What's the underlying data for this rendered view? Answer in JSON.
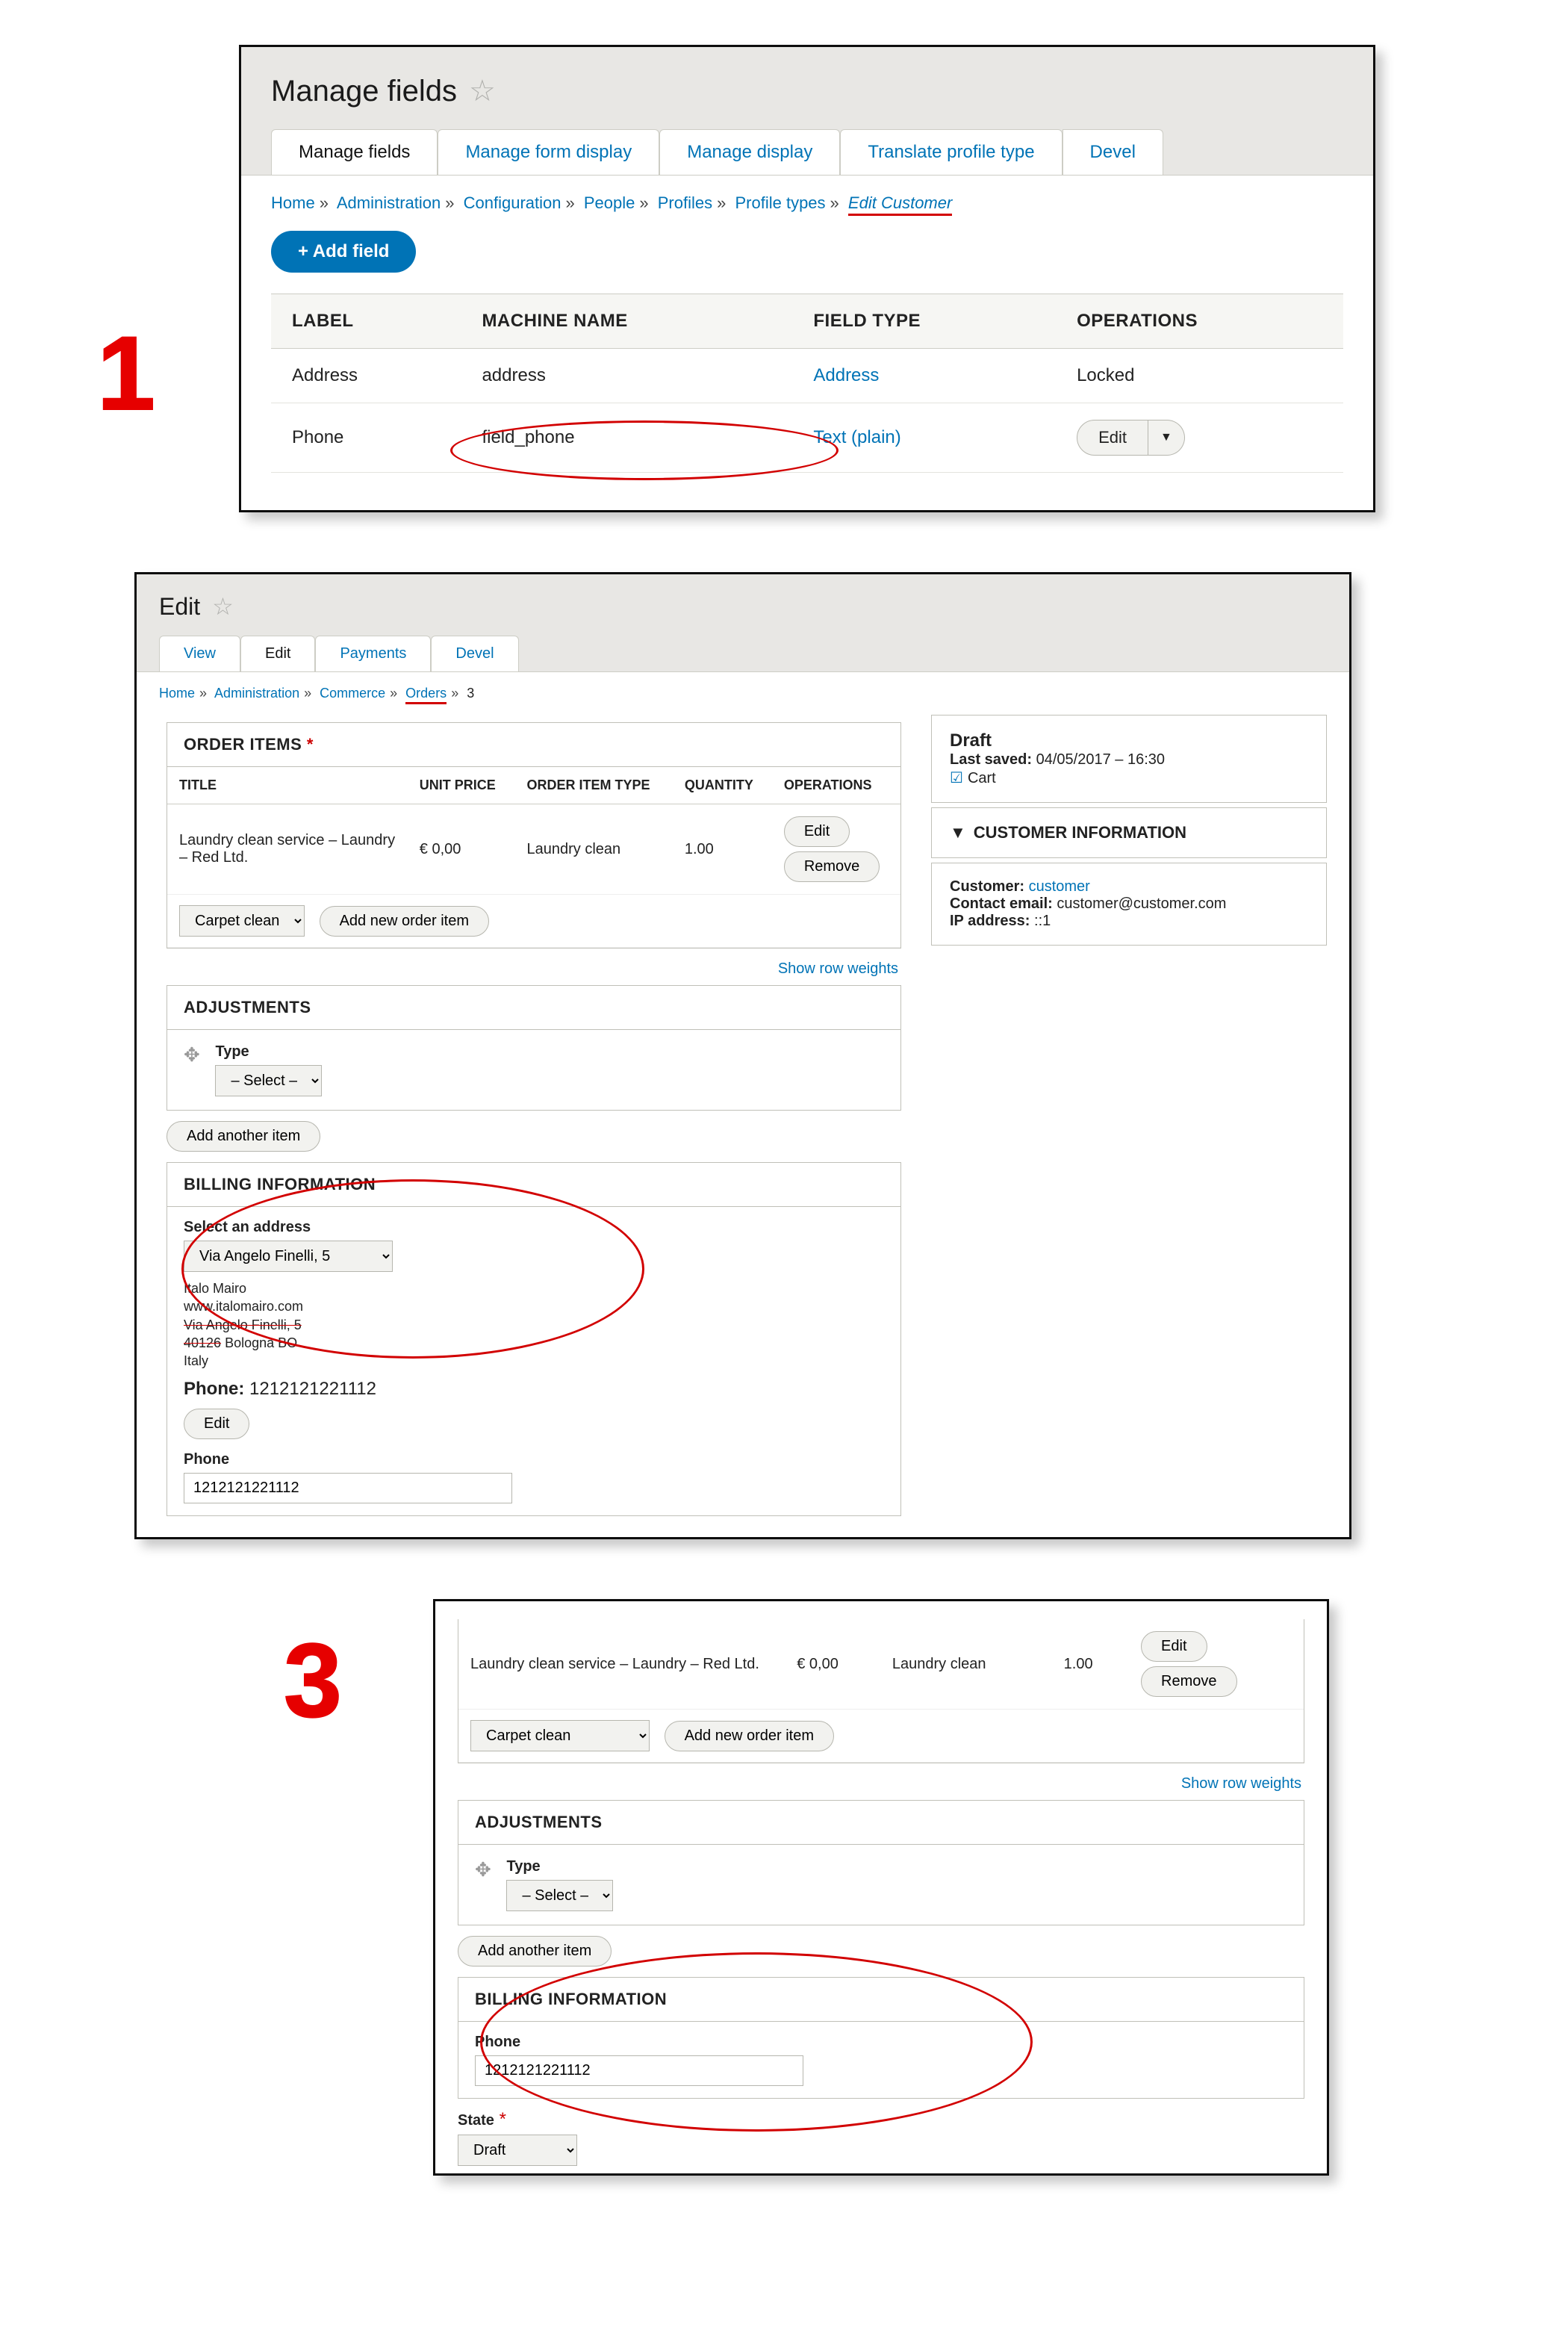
{
  "panel1": {
    "title": "Manage fields",
    "tabs": [
      "Manage fields",
      "Manage form display",
      "Manage display",
      "Translate profile type",
      "Devel"
    ],
    "breadcrumbs": [
      "Home",
      "Administration",
      "Configuration",
      "People",
      "Profiles",
      "Profile types",
      "Edit Customer"
    ],
    "add_btn": "+ Add field",
    "cols": [
      "LABEL",
      "MACHINE NAME",
      "FIELD TYPE",
      "OPERATIONS"
    ],
    "rows": [
      {
        "label": "Address",
        "machine": "address",
        "type": "Address",
        "op": "Locked"
      },
      {
        "label": "Phone",
        "machine": "field_phone",
        "type": "Text (plain)",
        "op": "Edit"
      }
    ]
  },
  "panel2": {
    "title": "Edit",
    "tabs": [
      "View",
      "Edit",
      "Payments",
      "Devel"
    ],
    "breadcrumbs": [
      "Home",
      "Administration",
      "Commerce",
      "Orders",
      "3"
    ],
    "order_items_label": "ORDER ITEMS",
    "oi_cols": [
      "TITLE",
      "UNIT PRICE",
      "ORDER ITEM TYPE",
      "QUANTITY",
      "OPERATIONS"
    ],
    "oi_row": {
      "title": "Laundry clean service – Laundry – Red Ltd.",
      "price": "€ 0,00",
      "type": "Laundry clean",
      "qty": "1.00",
      "edit": "Edit",
      "remove": "Remove"
    },
    "oi_select": "Carpet clean",
    "oi_add": "Add new order item",
    "show_row_weights": "Show row weights",
    "adjustments_label": "ADJUSTMENTS",
    "type_label": "Type",
    "type_select": "– Select –",
    "add_another": "Add another item",
    "billing_label": "BILLING INFORMATION",
    "select_addr": "Select an address",
    "addr_select": "Via Angelo Finelli, 5",
    "addr_lines": [
      "Italo Mairo",
      "www.italomairo.com",
      "Via Angelo Finelli, 5",
      "40126 Bologna BO",
      "Italy"
    ],
    "phone_lbl": "Phone:",
    "phone_val": "1212121221112",
    "edit_btn": "Edit",
    "phone_field_label": "Phone",
    "phone_input": "1212121221112",
    "right": {
      "draft": "Draft",
      "last_saved_lbl": "Last saved:",
      "last_saved": "04/05/2017 – 16:30",
      "cart": "Cart",
      "cust_info": "CUSTOMER INFORMATION",
      "customer_lbl": "Customer:",
      "customer": "customer",
      "email_lbl": "Contact email:",
      "email": "customer@customer.com",
      "ip_lbl": "IP address:",
      "ip": "::1"
    }
  },
  "panel3": {
    "oi_row": {
      "title": "Laundry clean service – Laundry – Red Ltd.",
      "price": "€ 0,00",
      "type": "Laundry clean",
      "qty": "1.00",
      "edit": "Edit",
      "remove": "Remove"
    },
    "oi_select": "Carpet clean",
    "oi_add": "Add new order item",
    "show_row_weights": "Show row weights",
    "adjustments_label": "ADJUSTMENTS",
    "type_label": "Type",
    "type_select": "– Select –",
    "add_another": "Add another item",
    "billing_label": "BILLING INFORMATION",
    "phone_label": "Phone",
    "phone_input": "1212121221112",
    "state_label": "State",
    "state_select": "Draft"
  }
}
